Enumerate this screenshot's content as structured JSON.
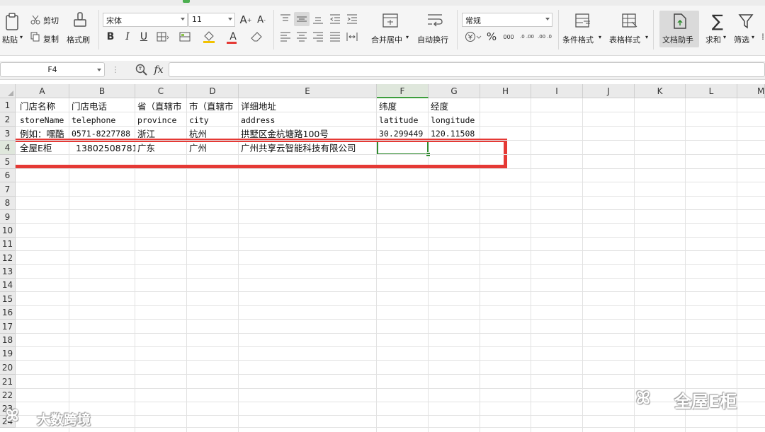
{
  "toolbar": {
    "paste": "粘贴",
    "cut": "剪切",
    "copy": "复制",
    "format_painter": "格式刷",
    "font_name": "宋体",
    "font_size": "11",
    "merge_center": "合并居中",
    "wrap_text": "自动换行",
    "number_format": "常规",
    "conditional_format": "条件格式",
    "table_style": "表格样式",
    "doc_assistant": "文档助手",
    "sum": "求和",
    "filter": "筛选",
    "bold": "B",
    "italic": "I",
    "underline": "U",
    "percent": "%",
    "thousands": "000",
    "dec_inc": ".0 .00",
    "dec_dec": ".00 .0",
    "font_grow": "A",
    "font_shrink": "A",
    "font_color": "A"
  },
  "formula_bar": {
    "name_box": "F4",
    "fx": "fx",
    "value": ""
  },
  "sheet": {
    "columns": [
      "A",
      "B",
      "C",
      "D",
      "E",
      "F",
      "G",
      "H",
      "I",
      "J",
      "K",
      "L",
      "M"
    ],
    "rows": [
      "1",
      "2",
      "3",
      "4",
      "5",
      "6",
      "7",
      "8",
      "9",
      "10",
      "11",
      "12",
      "13",
      "14",
      "15",
      "16",
      "17",
      "18",
      "19",
      "20",
      "21",
      "22",
      "23",
      "24"
    ],
    "selected_cell": "F4",
    "cells": {
      "r1": {
        "A": "门店名称",
        "B": "门店电话",
        "C": "省（直辖市",
        "D": "市（直辖市",
        "E": "详细地址",
        "F": "纬度",
        "G": "经度"
      },
      "r2": {
        "A": "storeName",
        "B": "telephone",
        "C": "province",
        "D": "city",
        "E": "address",
        "F": "latitude",
        "G": "longitude"
      },
      "r3": {
        "A": "例如：嘿酷",
        "B": "0571-8227788",
        "C": "浙江",
        "D": "杭州",
        "E": "拱墅区金杭塘路100号",
        "F": "30.299449",
        "G": "120.11508"
      },
      "r4": {
        "A": "全屋E柜",
        "B": "13802508781",
        "C": "广东",
        "D": "广州",
        "E": "广州共享云智能科技有限公司",
        "F": "",
        "G": ""
      }
    }
  },
  "watermarks": {
    "bottom_left": "大数跨境",
    "bottom_right": "全屋E柜"
  },
  "colors": {
    "highlight_box": "#e53935",
    "selection": "#2e8b2e"
  }
}
